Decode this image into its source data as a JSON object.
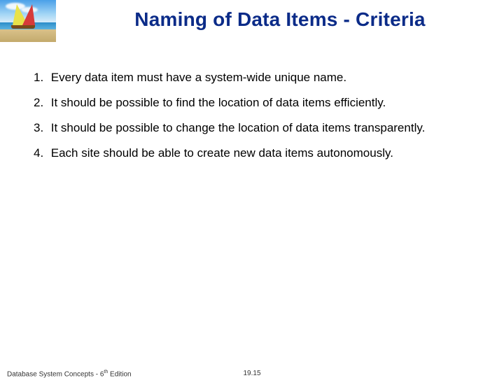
{
  "title": "Naming of Data Items - Criteria",
  "items": [
    {
      "num": "1.",
      "text": "Every data item must have a system-wide unique name."
    },
    {
      "num": "2.",
      "text": "It should be possible to find the location of data items efficiently."
    },
    {
      "num": "3.",
      "text": "It should be possible to change the location of data items transparently."
    },
    {
      "num": "4.",
      "text": "Each site should be able to create new data items autonomously."
    }
  ],
  "footer": {
    "left_prefix": "Database System Concepts - 6",
    "left_sup": "th",
    "left_suffix": " Edition",
    "page": "19.15"
  }
}
